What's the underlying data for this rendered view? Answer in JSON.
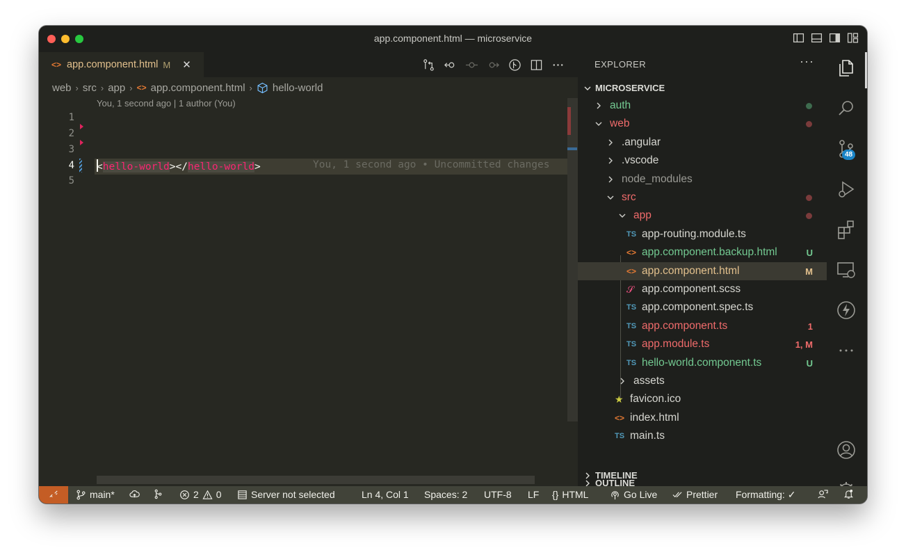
{
  "window": {
    "title": "app.component.html — microservice"
  },
  "tab": {
    "label": "app.component.html",
    "status": "M",
    "close": "✕",
    "icon": "<>"
  },
  "breadcrumb": {
    "parts": [
      "web",
      "src",
      "app",
      "app.component.html",
      "hello-world"
    ],
    "separator": "›"
  },
  "blame": {
    "header": "You, 1 second ago | 1 author (You)",
    "inline": "You, 1 second ago • Uncommitted changes"
  },
  "editor": {
    "line_numbers": [
      "1",
      "2",
      "3",
      "4",
      "5"
    ],
    "active_line": "4",
    "code": {
      "open_lt": "<",
      "tag_open": "hello-world",
      "mid": "></",
      "tag_close": "hello-world",
      "end_gt": ">"
    }
  },
  "explorer": {
    "title": "EXPLORER",
    "more": "···",
    "root": "MICROSERVICE",
    "items": [
      {
        "label": "auth",
        "icon": "chevron-right",
        "color": "#73c991",
        "dot": "#3e6b4e"
      },
      {
        "label": "web",
        "icon": "chevron-down",
        "color": "#ef6b6b",
        "dot": "#7a3b3b"
      },
      {
        "label": ".angular",
        "icon": "chevron-right",
        "color": "#d6d6d0"
      },
      {
        "label": ".vscode",
        "icon": "chevron-right",
        "color": "#d6d6d0"
      },
      {
        "label": "node_modules",
        "icon": "chevron-right",
        "color": "#9a9a94"
      },
      {
        "label": "src",
        "icon": "chevron-down",
        "color": "#ef6b6b",
        "dot": "#7a3b3b"
      },
      {
        "label": "app",
        "icon": "chevron-down",
        "color": "#ef6b6b",
        "dot": "#7a3b3b"
      },
      {
        "label": "app-routing.module.ts",
        "icon": "TS",
        "color": "#d6d6d0"
      },
      {
        "label": "app.component.backup.html",
        "icon": "<>",
        "color": "#73c991",
        "badge": "U"
      },
      {
        "label": "app.component.html",
        "icon": "<>",
        "color": "#e2c08d",
        "badge": "M",
        "selected": true
      },
      {
        "label": "app.component.scss",
        "icon": "scss",
        "color": "#d6d6d0"
      },
      {
        "label": "app.component.spec.ts",
        "icon": "TS",
        "color": "#d6d6d0"
      },
      {
        "label": "app.component.ts",
        "icon": "TS",
        "color": "#ef6b6b",
        "badge": "1"
      },
      {
        "label": "app.module.ts",
        "icon": "TS",
        "color": "#ef6b6b",
        "badge": "1, M"
      },
      {
        "label": "hello-world.component.ts",
        "icon": "TS",
        "color": "#73c991",
        "badge": "U"
      },
      {
        "label": "assets",
        "icon": "chevron-right",
        "color": "#d6d6d0"
      },
      {
        "label": "favicon.ico",
        "icon": "★",
        "color": "#d6d6d0"
      },
      {
        "label": "index.html",
        "icon": "<>",
        "color": "#d6d6d0"
      },
      {
        "label": "main.ts",
        "icon": "TS",
        "color": "#d6d6d0"
      }
    ],
    "sections": [
      "OUTLINE",
      "TIMELINE"
    ]
  },
  "activity": {
    "source_control_badge": "48"
  },
  "status": {
    "branch": "main*",
    "errors": "2",
    "warnings": "0",
    "server": "Server not selected",
    "position": "Ln 4, Col 1",
    "spaces": "Spaces: 2",
    "encoding": "UTF-8",
    "eol": "LF",
    "language": "HTML",
    "golive": "Go Live",
    "prettier": "Prettier",
    "formatting": "Formatting: ✓"
  }
}
